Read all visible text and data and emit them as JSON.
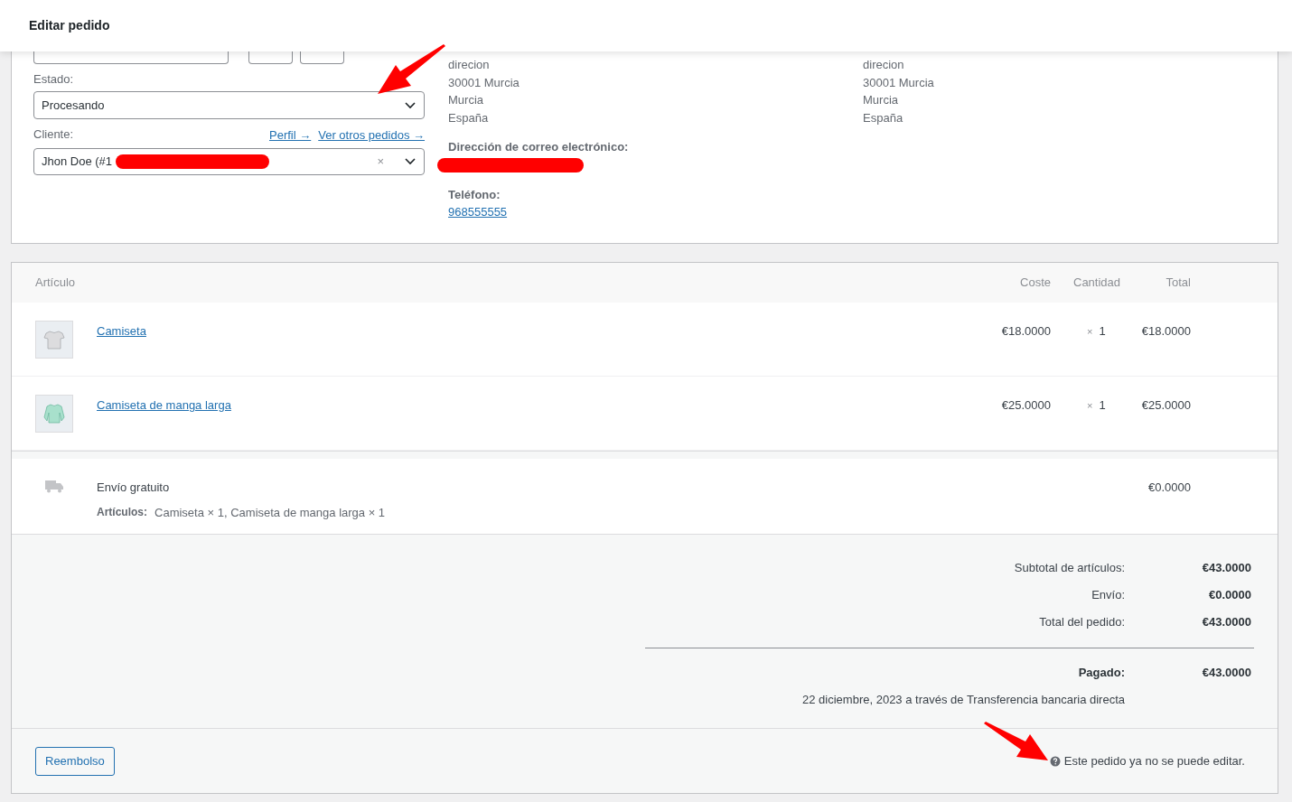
{
  "header": {
    "title": "Editar pedido"
  },
  "status": {
    "label": "Estado:",
    "value": "Procesando"
  },
  "customer": {
    "label": "Cliente:",
    "links": [
      "Perfil →",
      "Ver otros pedidos →"
    ],
    "value": "Jhon Doe (#1",
    "clear": "×"
  },
  "billing": {
    "lines": [
      "direcion",
      "30001 Murcia",
      "Murcia",
      "España"
    ],
    "email_label": "Dirección de correo electrónico:",
    "phone_label": "Teléfono:",
    "phone": "968555555"
  },
  "shipping_address": {
    "lines": [
      "direcion",
      "30001 Murcia",
      "Murcia",
      "España"
    ]
  },
  "items": {
    "columns": [
      "Artículo",
      "Coste",
      "Cantidad",
      "Total"
    ],
    "rows": [
      {
        "kind": "tshirt",
        "name": "Camiseta",
        "cost": "€18.0000",
        "times": "×",
        "qty": "1",
        "total": "€18.0000"
      },
      {
        "kind": "longsleeve",
        "name": "Camiseta de manga larga",
        "cost": "€25.0000",
        "times": "×",
        "qty": "1",
        "total": "€25.0000"
      }
    ]
  },
  "shipping_line": {
    "name": "Envío gratuito",
    "meta_label": "Artículos:",
    "meta_value": "Camiseta × 1, Camiseta de manga larga × 1",
    "total": "€0.0000"
  },
  "totals": [
    {
      "label": "Subtotal de artículos:",
      "value": "€43.0000"
    },
    {
      "label": "Envío:",
      "value": "€0.0000"
    },
    {
      "label": "Total del pedido:",
      "value": "€43.0000"
    }
  ],
  "paid": {
    "label": "Pagado:",
    "value": "€43.0000",
    "note": "22 diciembre, 2023 a través de Transferencia bancaria directa"
  },
  "footer": {
    "refund": "Reembolso",
    "notice": "Este pedido ya no se puede editar."
  }
}
